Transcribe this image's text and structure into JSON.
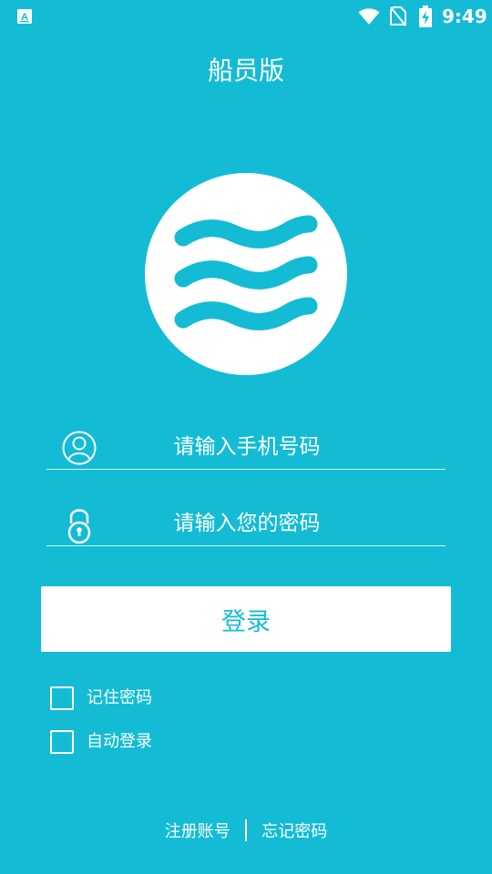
{
  "status_bar": {
    "app_icon": "a-letter-icon",
    "time": "9:49",
    "icons": [
      "wifi-icon",
      "no-sim-icon",
      "battery-charging-icon"
    ]
  },
  "header": {
    "title": "船员版"
  },
  "logo": {
    "icon": "waves-logo-icon"
  },
  "form": {
    "phone": {
      "icon": "user-icon",
      "placeholder": "请输入手机号码",
      "value": ""
    },
    "password": {
      "icon": "lock-icon",
      "placeholder": "请输入您的密码",
      "value": ""
    },
    "login_label": "登录",
    "remember_label": "记住密码",
    "remember_checked": false,
    "auto_login_label": "自动登录",
    "auto_login_checked": false
  },
  "footer": {
    "register_label": "注册账号",
    "forgot_label": "忘记密码"
  },
  "colors": {
    "background": "#13bcd4",
    "accent": "#13bcd4",
    "button_bg": "#ffffff",
    "text": "#ffffff"
  }
}
